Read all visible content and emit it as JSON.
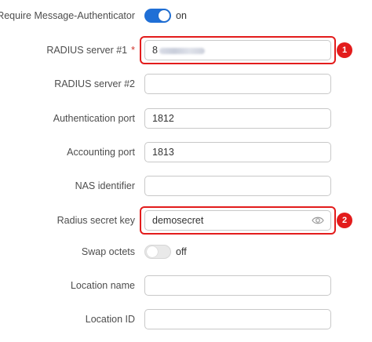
{
  "form": {
    "require_msg_auth": {
      "label": "Require Message-Authenticator",
      "state": "on"
    },
    "radius_server_1": {
      "label": "RADIUS server #1",
      "required": "*",
      "value_visible": "8",
      "badge": "1"
    },
    "radius_server_2": {
      "label": "RADIUS server #2",
      "value": ""
    },
    "auth_port": {
      "label": "Authentication port",
      "value": "1812"
    },
    "acct_port": {
      "label": "Accounting port",
      "value": "1813"
    },
    "nas_identifier": {
      "label": "NAS identifier",
      "value": ""
    },
    "radius_secret": {
      "label": "Radius secret key",
      "value": "demosecret",
      "badge": "2",
      "icon": "eye-icon"
    },
    "swap_octets": {
      "label": "Swap octets",
      "state": "off"
    },
    "location_name": {
      "label": "Location name",
      "value": ""
    },
    "location_id": {
      "label": "Location ID",
      "value": ""
    }
  },
  "colors": {
    "accent": "#1f6fd6",
    "highlight": "#e31c1c",
    "required_star": "#d0342c"
  }
}
